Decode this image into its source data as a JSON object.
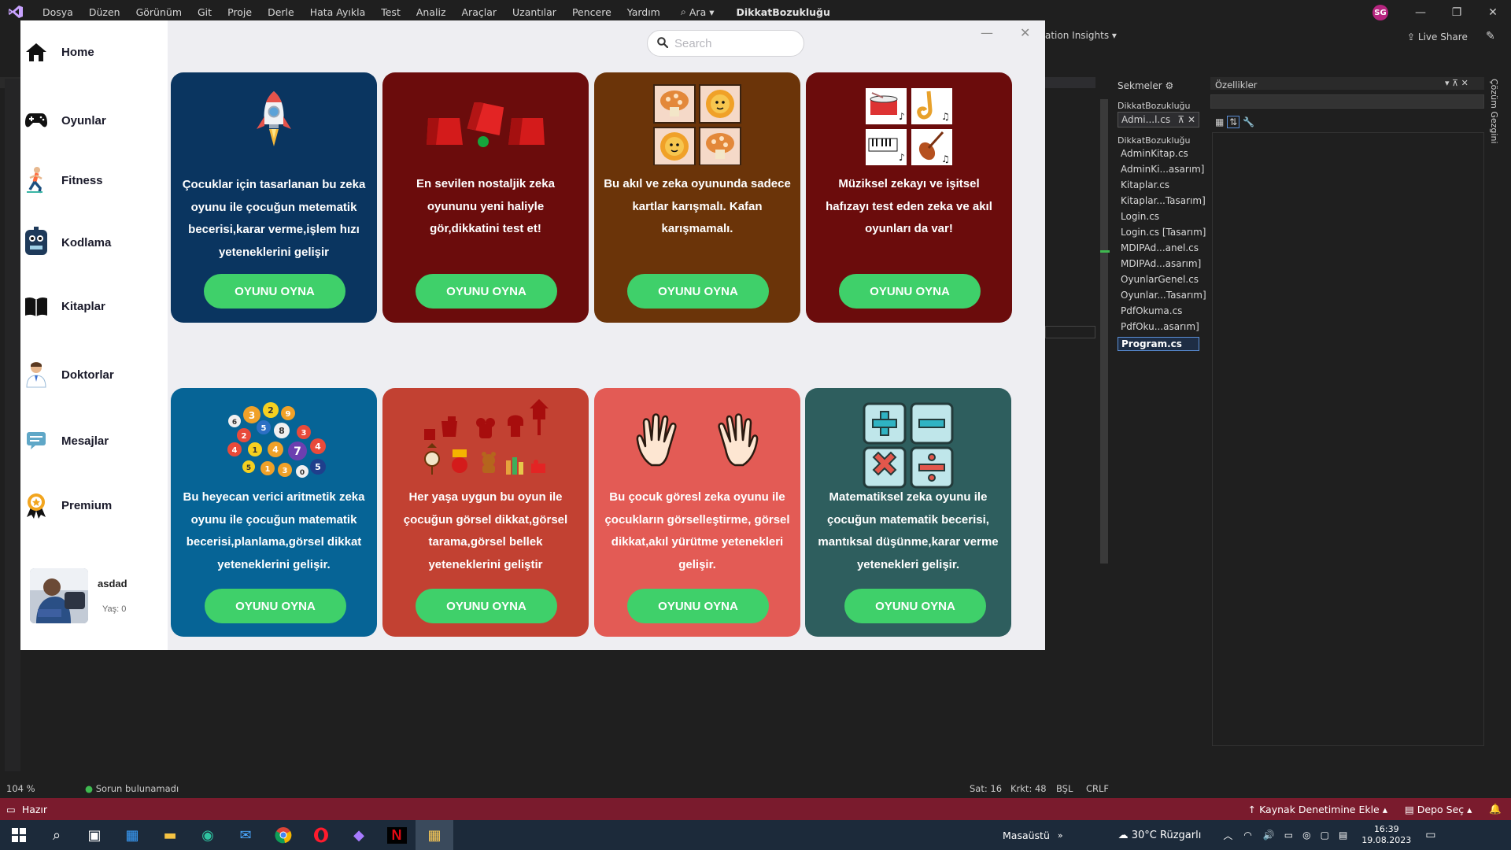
{
  "vs": {
    "menu": [
      "Dosya",
      "Düzen",
      "Görünüm",
      "Git",
      "Proje",
      "Derle",
      "Hata Ayıkla",
      "Test",
      "Analiz",
      "Araçlar",
      "Uzantılar",
      "Pencere",
      "Yardım"
    ],
    "search_label": "Ara",
    "project_name": "DikkatBozukluğu",
    "user_initials": "SG",
    "insights_label": "ation Insights",
    "live_share": "Live Share",
    "tabs_panel_title": "Sekmeler",
    "properties_title": "Özellikler",
    "solution_explorer_vertical": "Çözüm Gezgini",
    "tabs_group_label": "DikkatBozukluğu",
    "active_tab": "Admi...l.cs",
    "solution_group_label": "DikkatBozukluğu",
    "solution_files": [
      "AdminKitap.cs",
      "AdminKi...asarım]",
      "Kitaplar.cs",
      "Kitaplar...Tasarım]",
      "Login.cs",
      "Login.cs [Tasarım]",
      "MDIPAd...anel.cs",
      "MDIPAd...asarım]",
      "OyunlarGenel.cs",
      "Oyunlar...Tasarım]",
      "PdfOkuma.cs",
      "PdfOku...asarım]",
      "Program.cs"
    ],
    "status": {
      "zoom": "104 %",
      "issues": "Sorun bulunamadı",
      "line": "Sat: 16",
      "col": "Krkt: 48",
      "mode": "BŞL",
      "eol": "CRLF"
    },
    "bottom_bar": {
      "ready": "Hazır",
      "source_control": "Kaynak Denetimine Ekle",
      "repo": "Depo Seç"
    }
  },
  "taskbar": {
    "desktop": "Masaüstü",
    "weather": "30°C Rüzgarlı",
    "time": "16:39",
    "date": "19.08.2023"
  },
  "app": {
    "search_placeholder": "Search",
    "nav": [
      {
        "label": "Home",
        "icon": "home-icon"
      },
      {
        "label": "Oyunlar",
        "icon": "gamepad-icon"
      },
      {
        "label": "Fitness",
        "icon": "runner-icon"
      },
      {
        "label": "Kodlama",
        "icon": "robot-icon"
      },
      {
        "label": "Kitaplar",
        "icon": "book-icon"
      },
      {
        "label": "Doktorlar",
        "icon": "doctor-icon"
      },
      {
        "label": "Mesajlar",
        "icon": "message-icon"
      },
      {
        "label": "Premium",
        "icon": "premium-badge-icon"
      }
    ],
    "user": {
      "name": "asdad",
      "age_label": "Yaş: 0"
    },
    "play_label": "OYUNU OYNA",
    "cards": [
      {
        "text": "Çocuklar için tasarlanan bu zeka oyunu ile çocuğun metematik becerisi,karar verme,işlem hızı yeteneklerini gelişir",
        "color": "#0a3560",
        "art": "rocket-icon"
      },
      {
        "text": "En sevilen nostaljik zeka oyununu yeni haliyle gör,dikkatini test et!",
        "color": "#6b0c0c",
        "art": "cups-ball-icon"
      },
      {
        "text": "Bu akıl ve zeka oyununda sadece kartlar karışmalı. Kafan karışmamalı.",
        "color": "#6b3409",
        "art": "memory-cards-icon"
      },
      {
        "text": "Müziksel zekayı ve işitsel hafızayı test eden zeka ve akıl oyunları da var!",
        "color": "#6b0c0c",
        "art": "instruments-icon"
      },
      {
        "text": "Bu heyecan verici aritmetik zeka oyunu ile çocuğun matematik becerisi,planlama,görsel dikkat yeteneklerini gelişir.",
        "color": "#066496",
        "art": "number-balls-icon"
      },
      {
        "text": "Her yaşa uygun bu oyun ile çocuğun görsel dikkat,görsel tarama,görsel bellek yeteneklerini geliştir",
        "color": "#c24132",
        "art": "objects-icon"
      },
      {
        "text": "Bu çocuk göresl zeka oyunu ile çocukların görselleştirme, görsel dikkat,akıl yürütme yetenekleri gelişir.",
        "color": "#e35b55",
        "art": "hands-icon"
      },
      {
        "text": "Matematiksel zeka oyunu ile çocuğun matematik becerisi, mantıksal düşünme,karar verme yetenekleri gelişir.",
        "color": "#2e5e5e",
        "art": "math-ops-icon"
      }
    ]
  }
}
